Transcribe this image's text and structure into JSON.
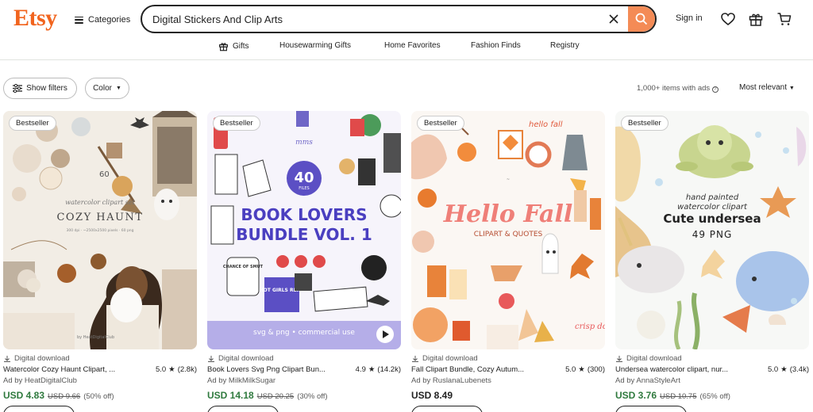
{
  "brand": "Etsy",
  "header": {
    "categories_label": "Categories",
    "search_value": "Digital Stickers And Clip Arts",
    "signin_label": "Sign in"
  },
  "subnav": [
    {
      "label": "Gifts",
      "icon": "gift-icon"
    },
    {
      "label": "Housewarming Gifts"
    },
    {
      "label": "Home Favorites"
    },
    {
      "label": "Fashion Finds"
    },
    {
      "label": "Registry"
    }
  ],
  "filters": {
    "show_filters": "Show filters",
    "color": "Color",
    "results": "1,000+ items with ads",
    "sort": "Most relevant"
  },
  "products": [
    {
      "badge": "Bestseller",
      "delivery": "Digital download",
      "title": "Watercolor Cozy Haunt Clipart, ...",
      "rating": "5.0",
      "reviews": "(2.8k)",
      "ad": "Ad by HeatDigitalClub",
      "price": "USD 4.83",
      "original": "USD 9.66",
      "discount": "(50% off)",
      "art": {
        "text1": "60",
        "text2": "watercolor clipart set",
        "text3": "COZY HAUNT",
        "text4": "300 dpi · ~2500x2500 pixels · 60 png",
        "text5": "by HeatDigitalClub"
      }
    },
    {
      "badge": "Bestseller",
      "delivery": "Digital download",
      "title": "Book Lovers Svg Png Clipart Bun...",
      "rating": "4.9",
      "reviews": "(14.2k)",
      "ad": "Ad by MilkMilkSugar",
      "price": "USD 14.18",
      "original": "USD 20.25",
      "discount": "(30% off)",
      "art": {
        "text1": "mms",
        "text2": "40",
        "text3": "FILES",
        "text4": "BOOK LOVERS",
        "text5": "BUNDLE VOL. 1",
        "text6": "svg & png • commercial use",
        "text7": "HOT GIRLS READ",
        "text8": "CHANCE OF SMUT"
      }
    },
    {
      "badge": "Bestseller",
      "delivery": "Digital download",
      "title": "Fall Clipart Bundle, Cozy Autum...",
      "rating": "5.0",
      "reviews": "(300)",
      "ad": "Ad by RuslanaLubenets",
      "price": "USD 8.49",
      "art": {
        "text1": "Hello Fall",
        "text2": "CLIPART & QUOTES",
        "text3": "hello fall",
        "text4": "crisp don't"
      }
    },
    {
      "badge": "Bestseller",
      "delivery": "Digital download",
      "title": "Undersea watercolor clipart, nur...",
      "rating": "5.0",
      "reviews": "(3.4k)",
      "ad": "Ad by AnnaStyleArt",
      "price": "USD 3.76",
      "original": "USD 10.75",
      "discount": "(65% off)",
      "art": {
        "text1": "hand painted",
        "text2": "watercolor clipart",
        "text3": "Cute undersea",
        "text4": "49 PNG"
      }
    }
  ],
  "colors": {
    "brand": "#f1641e",
    "sale": "#2f7a3e"
  }
}
